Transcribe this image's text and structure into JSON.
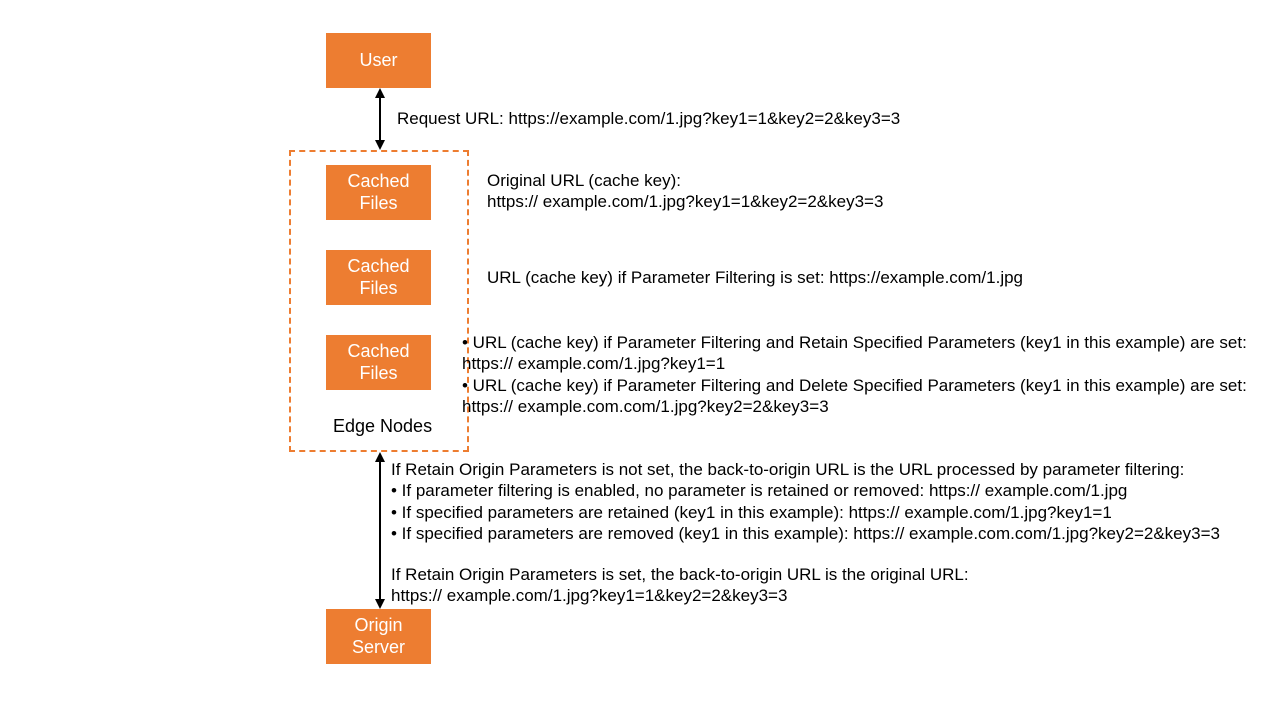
{
  "user_box": "User",
  "cached_box": "Cached\nFiles",
  "edge_nodes_label": "Edge Nodes",
  "origin_box": "Origin\nServer",
  "request_url": "Request URL: https://example.com/1.jpg?key1=1&key2=2&key3=3",
  "cache1_line1": "Original URL (cache key):",
  "cache1_line2": "https:// example.com/1.jpg?key1=1&key2=2&key3=3",
  "cache2": "URL (cache key) if Parameter Filtering is set: https://example.com/1.jpg",
  "cache3_l1": "•   URL (cache key) if Parameter Filtering and Retain Specified Parameters (key1 in this example) are set:",
  "cache3_l2": "https:// example.com/1.jpg?key1=1",
  "cache3_l3": "•   URL (cache key) if Parameter Filtering and Delete Specified Parameters (key1 in this example) are set:",
  "cache3_l4": "https:// example.com.com/1.jpg?key2=2&key3=3",
  "origin_p1_l1": "If Retain Origin Parameters is not set, the back-to-origin URL is the URL processed by parameter filtering:",
  "origin_p1_l2": "•   If parameter filtering is enabled, no parameter is retained or removed: https:// example.com/1.jpg",
  "origin_p1_l3": "•   If specified parameters are retained (key1 in this example): https:// example.com/1.jpg?key1=1",
  "origin_p1_l4": "•   If specified parameters are removed (key1 in this example): https:// example.com.com/1.jpg?key2=2&key3=3",
  "origin_p2_l1": "If Retain Origin Parameters is set, the back-to-origin URL is the original URL:",
  "origin_p2_l2": "https:// example.com/1.jpg?key1=1&key2=2&key3=3"
}
